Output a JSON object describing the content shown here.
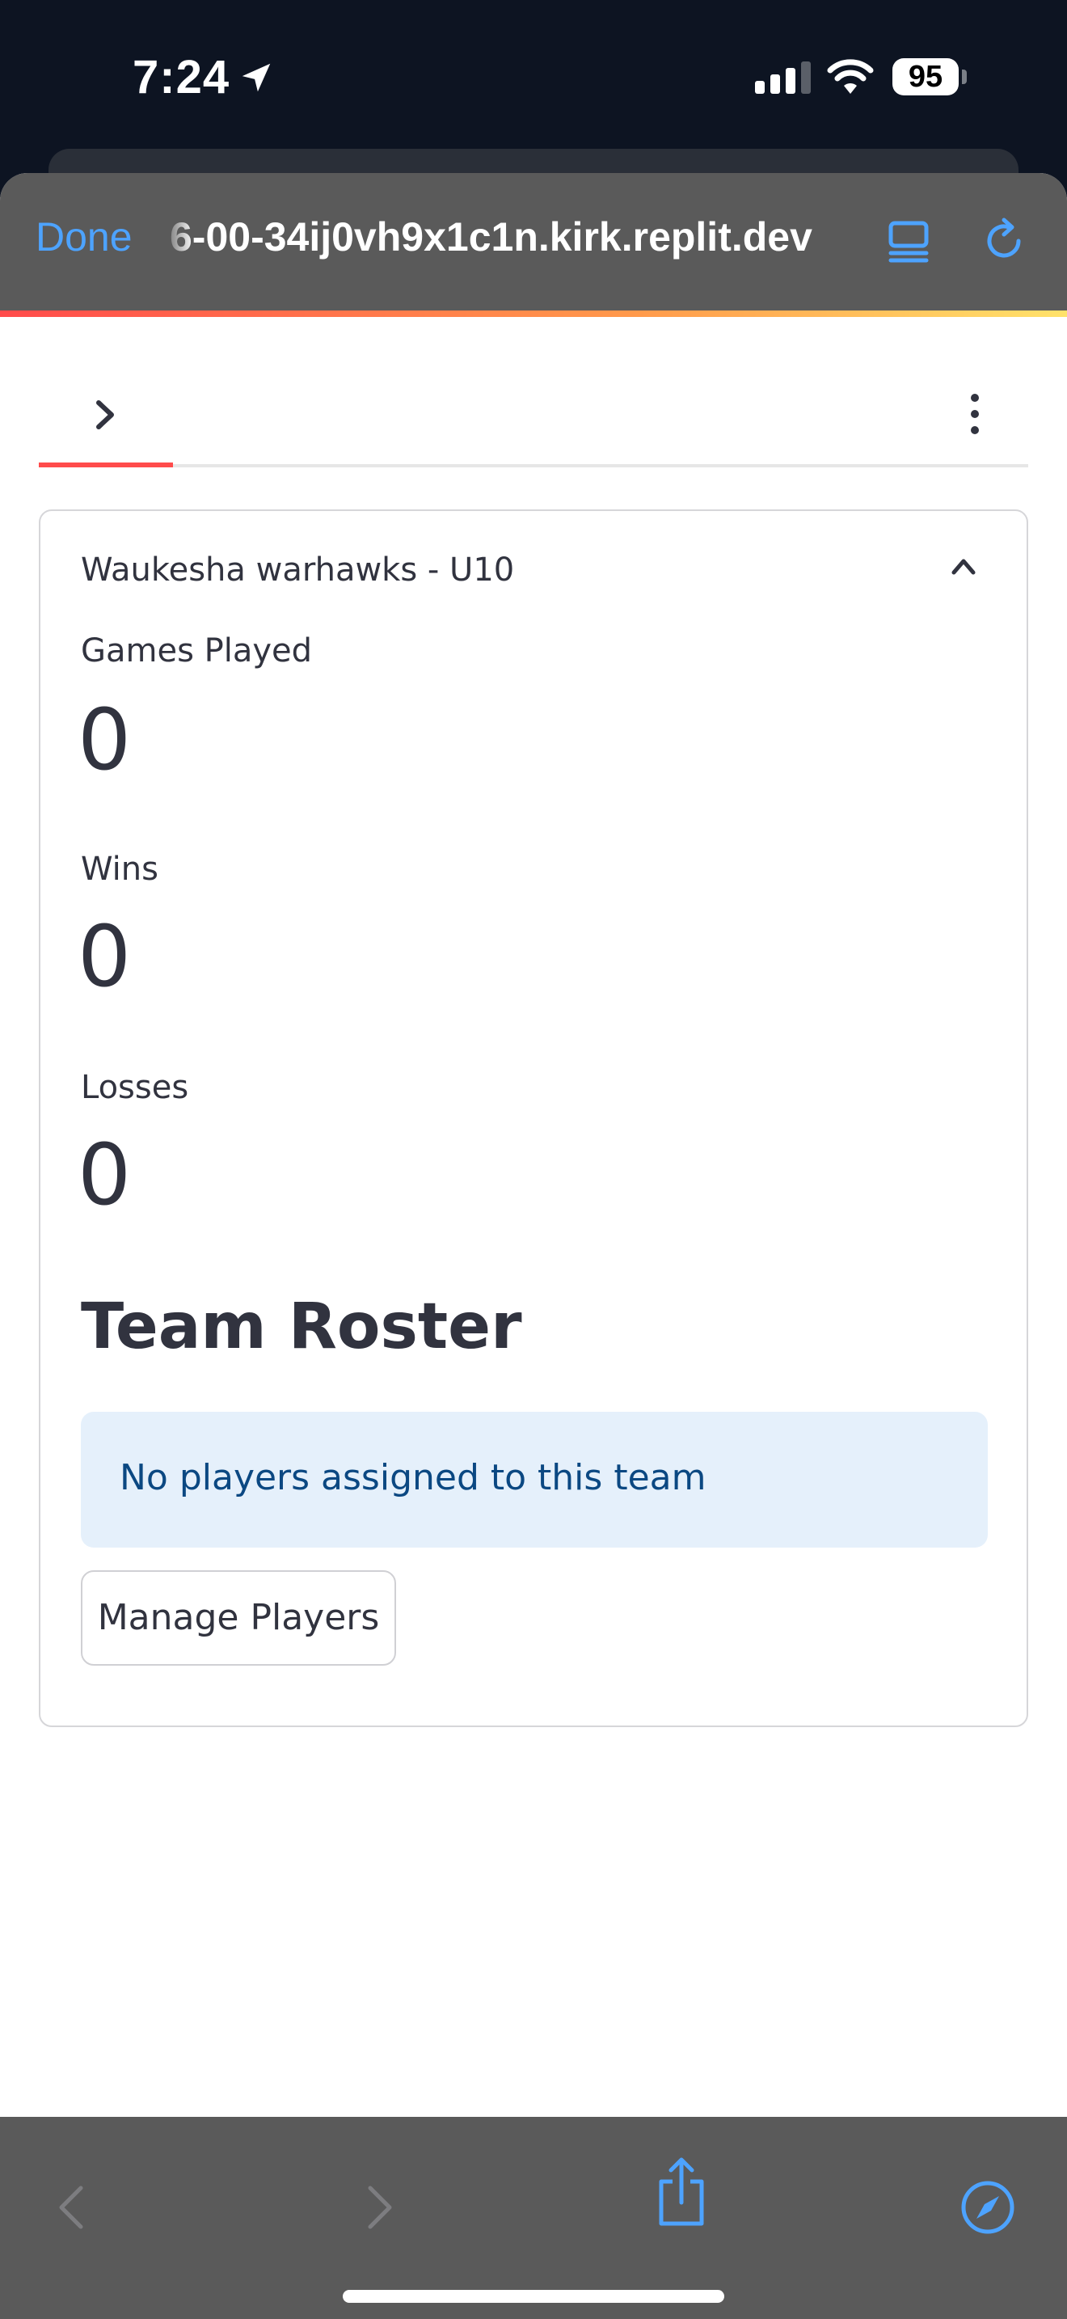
{
  "status_bar": {
    "time": "7:24",
    "battery": "95",
    "icons": [
      "location-arrow-icon",
      "cellular-signal-icon",
      "wifi-icon",
      "battery-icon"
    ]
  },
  "browser": {
    "done_label": "Done",
    "url": "6-00-34ij0vh9x1c1n.kirk.replit.dev",
    "accent_color": "#4da3ff",
    "icons": [
      "tabs-icon",
      "reload-icon"
    ]
  },
  "page": {
    "header_icons": [
      "chevron-right-icon",
      "more-vertical-icon"
    ],
    "expander": {
      "title": "Waukesha warhawks - U10",
      "metrics": [
        {
          "label": "Games Played",
          "value": "0"
        },
        {
          "label": "Wins",
          "value": "0"
        },
        {
          "label": "Losses",
          "value": "0"
        }
      ],
      "roster_title": "Team Roster",
      "info_message": "No players assigned to this team",
      "manage_button": "Manage Players"
    },
    "accent_color": "#ff4b4b"
  },
  "toolbar": {
    "icons": [
      "back-arrow-icon",
      "forward-arrow-icon",
      "share-icon",
      "compass-icon"
    ]
  }
}
